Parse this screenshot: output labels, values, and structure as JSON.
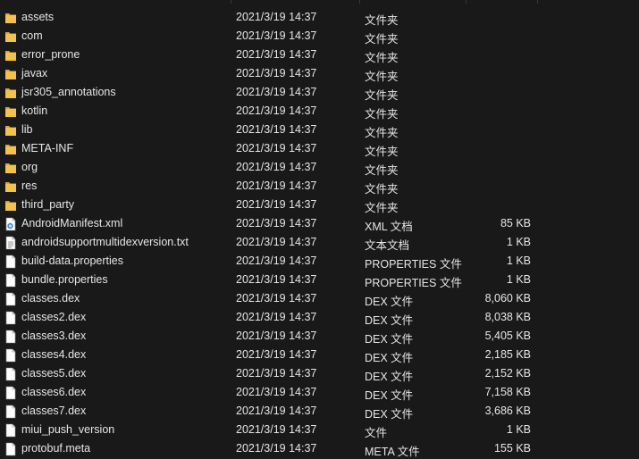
{
  "files": [
    {
      "name": "assets",
      "date": "2021/3/19 14:37",
      "type": "文件夹",
      "size": "",
      "icon": "folder-icon"
    },
    {
      "name": "com",
      "date": "2021/3/19 14:37",
      "type": "文件夹",
      "size": "",
      "icon": "folder-icon"
    },
    {
      "name": "error_prone",
      "date": "2021/3/19 14:37",
      "type": "文件夹",
      "size": "",
      "icon": "folder-icon"
    },
    {
      "name": "javax",
      "date": "2021/3/19 14:37",
      "type": "文件夹",
      "size": "",
      "icon": "folder-icon"
    },
    {
      "name": "jsr305_annotations",
      "date": "2021/3/19 14:37",
      "type": "文件夹",
      "size": "",
      "icon": "folder-icon"
    },
    {
      "name": "kotlin",
      "date": "2021/3/19 14:37",
      "type": "文件夹",
      "size": "",
      "icon": "folder-icon"
    },
    {
      "name": "lib",
      "date": "2021/3/19 14:37",
      "type": "文件夹",
      "size": "",
      "icon": "folder-icon"
    },
    {
      "name": "META-INF",
      "date": "2021/3/19 14:37",
      "type": "文件夹",
      "size": "",
      "icon": "folder-icon"
    },
    {
      "name": "org",
      "date": "2021/3/19 14:37",
      "type": "文件夹",
      "size": "",
      "icon": "folder-icon"
    },
    {
      "name": "res",
      "date": "2021/3/19 14:37",
      "type": "文件夹",
      "size": "",
      "icon": "folder-icon"
    },
    {
      "name": "third_party",
      "date": "2021/3/19 14:37",
      "type": "文件夹",
      "size": "",
      "icon": "folder-icon"
    },
    {
      "name": "AndroidManifest.xml",
      "date": "2021/3/19 14:37",
      "type": "XML 文档",
      "size": "85 KB",
      "icon": "xml-file-icon"
    },
    {
      "name": "androidsupportmultidexversion.txt",
      "date": "2021/3/19 14:37",
      "type": "文本文档",
      "size": "1 KB",
      "icon": "text-file-icon"
    },
    {
      "name": "build-data.properties",
      "date": "2021/3/19 14:37",
      "type": "PROPERTIES 文件",
      "size": "1 KB",
      "icon": "file-icon"
    },
    {
      "name": "bundle.properties",
      "date": "2021/3/19 14:37",
      "type": "PROPERTIES 文件",
      "size": "1 KB",
      "icon": "file-icon"
    },
    {
      "name": "classes.dex",
      "date": "2021/3/19 14:37",
      "type": "DEX 文件",
      "size": "8,060 KB",
      "icon": "file-icon"
    },
    {
      "name": "classes2.dex",
      "date": "2021/3/19 14:37",
      "type": "DEX 文件",
      "size": "8,038 KB",
      "icon": "file-icon"
    },
    {
      "name": "classes3.dex",
      "date": "2021/3/19 14:37",
      "type": "DEX 文件",
      "size": "5,405 KB",
      "icon": "file-icon"
    },
    {
      "name": "classes4.dex",
      "date": "2021/3/19 14:37",
      "type": "DEX 文件",
      "size": "2,185 KB",
      "icon": "file-icon"
    },
    {
      "name": "classes5.dex",
      "date": "2021/3/19 14:37",
      "type": "DEX 文件",
      "size": "2,152 KB",
      "icon": "file-icon"
    },
    {
      "name": "classes6.dex",
      "date": "2021/3/19 14:37",
      "type": "DEX 文件",
      "size": "7,158 KB",
      "icon": "file-icon"
    },
    {
      "name": "classes7.dex",
      "date": "2021/3/19 14:37",
      "type": "DEX 文件",
      "size": "3,686 KB",
      "icon": "file-icon"
    },
    {
      "name": "miui_push_version",
      "date": "2021/3/19 14:37",
      "type": "文件",
      "size": "1 KB",
      "icon": "file-icon"
    },
    {
      "name": "protobuf.meta",
      "date": "2021/3/19 14:37",
      "type": "META 文件",
      "size": "155 KB",
      "icon": "file-icon"
    }
  ],
  "colors": {
    "background": "#191919",
    "text": "#e6e6e6",
    "folder": "#f3c24b",
    "folder_dark": "#d9a52e",
    "file": "#ffffff"
  }
}
